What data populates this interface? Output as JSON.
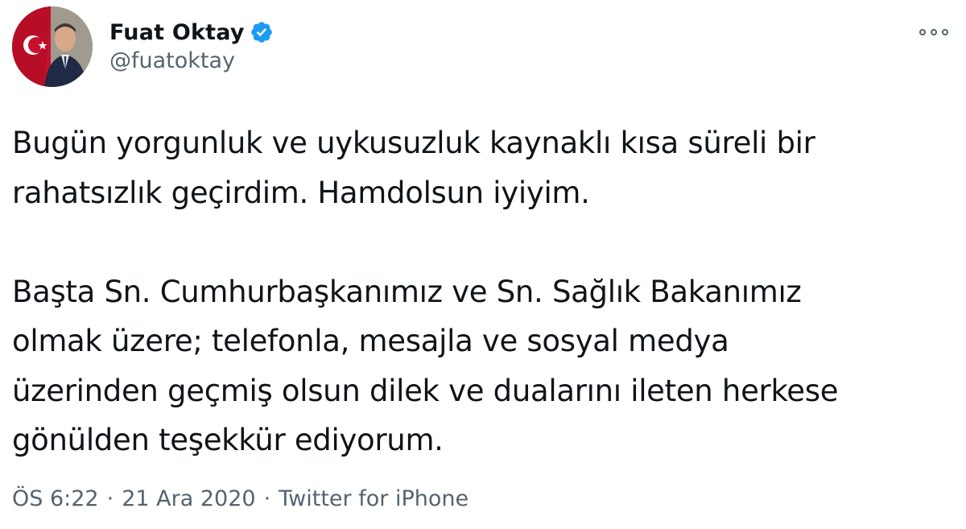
{
  "author": {
    "display_name": "Fuat Oktay",
    "handle": "@fuatoktay",
    "verified": true,
    "verified_badge_color": "#1d9bf0"
  },
  "tweet": {
    "paragraphs": [
      {
        "lines": [
          "Bugün yorgunluk ve uykusuzluk kaynaklı kısa süreli bir",
          "rahatsızlık geçirdim. Hamdolsun iyiyim."
        ]
      },
      {
        "lines": [
          "Başta Sn. Cumhurbaşkanımız ve Sn. Sağlık Bakanımız",
          "olmak üzere; telefonla, mesajla ve sosyal medya",
          "üzerinden geçmiş olsun dilek ve dualarını ileten herkese",
          "gönülden teşekkür ediyorum."
        ]
      }
    ]
  },
  "meta": {
    "time": "ÖS 6:22",
    "separator": "·",
    "date": "21 Ara 2020",
    "source": "Twitter for iPhone"
  },
  "icons": {
    "more": "more-options-icon",
    "verified": "verified-badge-icon"
  },
  "colors": {
    "text_primary": "#0f1419",
    "text_secondary": "#536471",
    "accent": "#1d9bf0"
  }
}
